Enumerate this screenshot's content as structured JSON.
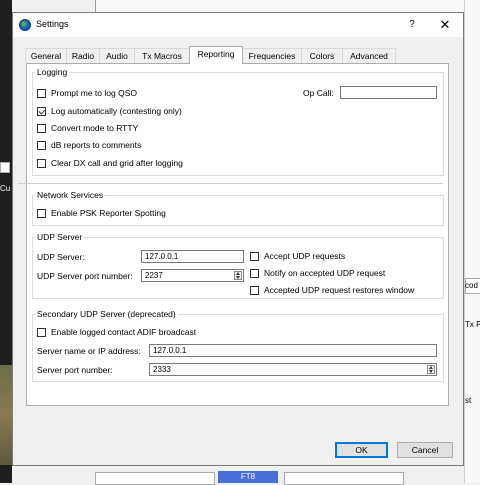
{
  "dialog": {
    "title": "Settings",
    "help": "?",
    "close": "✕"
  },
  "tabs": [
    {
      "label": "General"
    },
    {
      "label": "Radio"
    },
    {
      "label": "Audio"
    },
    {
      "label": "Tx Macros"
    },
    {
      "label": "Reporting",
      "active": true
    },
    {
      "label": "Frequencies"
    },
    {
      "label": "Colors"
    },
    {
      "label": "Advanced"
    }
  ],
  "logging": {
    "title": "Logging",
    "prompt_log_qso": {
      "label": "Prompt me to log QSO",
      "checked": false
    },
    "log_auto": {
      "label": "Log automatically (contesting only)",
      "checked": true
    },
    "convert_rtty": {
      "label": "Convert mode to RTTY",
      "checked": false
    },
    "db_reports": {
      "label": "dB reports to comments",
      "checked": false
    },
    "clear_dx": {
      "label": "Clear DX call and grid after logging",
      "checked": false
    },
    "op_call_label": "Op Call:",
    "op_call_value": ""
  },
  "network": {
    "title": "Network Services",
    "psk_reporter": {
      "label": "Enable PSK Reporter Spotting",
      "checked": false
    }
  },
  "udp": {
    "title": "UDP Server",
    "server_label": "UDP Server:",
    "server_value": "127.0.0.1",
    "port_label": "UDP Server port number:",
    "port_value": "2237",
    "accept": {
      "label": "Accept UDP requests",
      "checked": false
    },
    "notify": {
      "label": "Notify on accepted UDP request",
      "checked": false
    },
    "restore": {
      "label": "Accepted UDP request restores window",
      "checked": false
    }
  },
  "secondary_udp": {
    "title": "Secondary UDP Server (deprecated)",
    "adif": {
      "label": "Enable logged contact ADIF broadcast",
      "checked": false
    },
    "server_label": "Server name or IP address:",
    "server_value": "127.0.0.1",
    "port_label": "Server port number:",
    "port_value": "2333"
  },
  "buttons": {
    "ok": "OK",
    "cancel": "Cancel"
  },
  "background": {
    "left_a": "Cu",
    "right_a": "cod",
    "right_b": "Tx F",
    "right_c": "st",
    "mode": "FT8"
  }
}
